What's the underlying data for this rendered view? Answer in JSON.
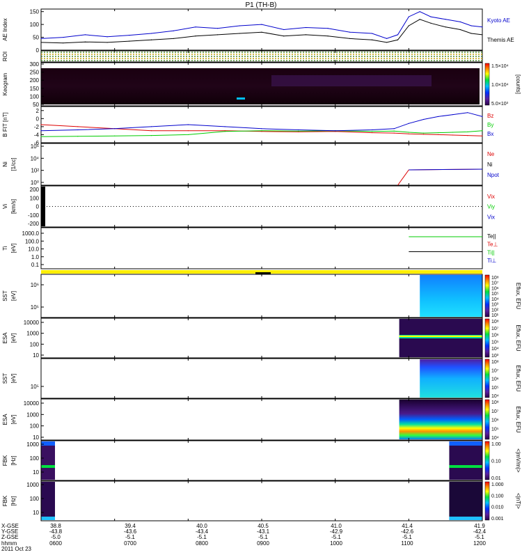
{
  "title": "P1 (TH-B)",
  "time_axis": {
    "ticks": [
      "0600",
      "0700",
      "0800",
      "0900",
      "1000",
      "1100",
      "1200"
    ],
    "header_rows": [
      "X-GSE",
      "Y-GSE",
      "Z-GSE",
      "hhmm"
    ],
    "columns": [
      {
        "x": "38.8",
        "y": "-43.8",
        "z": "-5.0",
        "t": "0600"
      },
      {
        "x": "39.4",
        "y": "-43.6",
        "z": "-5.1",
        "t": "0700"
      },
      {
        "x": "40.0",
        "y": "-43.4",
        "z": "-5.1",
        "t": "0800"
      },
      {
        "x": "40.5",
        "y": "-43.1",
        "z": "-5.1",
        "t": "0900"
      },
      {
        "x": "41.0",
        "y": "-42.9",
        "z": "-5.1",
        "t": "1000"
      },
      {
        "x": "41.4",
        "y": "-42.6",
        "z": "-5.1",
        "t": "1100"
      },
      {
        "x": "41.9",
        "y": "-42.4",
        "z": "-5.1",
        "t": "1200"
      }
    ],
    "date": "2011 Oct 23"
  },
  "chart_data": [
    {
      "type": "line",
      "ylabel": "AE Index",
      "yticks": [
        "150",
        "100",
        "50",
        "0"
      ],
      "ylim": [
        0,
        160
      ],
      "x": [
        6.0,
        6.3,
        6.6,
        6.9,
        7.2,
        7.5,
        7.8,
        8.1,
        8.4,
        8.7,
        9.0,
        9.3,
        9.6,
        9.9,
        10.2,
        10.5,
        10.7,
        10.85,
        11.0,
        11.15,
        11.3,
        11.5,
        11.7,
        11.85,
        12.0
      ],
      "series": [
        {
          "name": "Kyoto AE",
          "color": "#0000cc",
          "values": [
            45,
            50,
            60,
            52,
            58,
            65,
            75,
            90,
            85,
            95,
            100,
            80,
            88,
            85,
            70,
            65,
            45,
            60,
            130,
            150,
            130,
            120,
            110,
            95,
            90
          ]
        },
        {
          "name": "Themis AE",
          "color": "#000000",
          "values": [
            30,
            28,
            32,
            30,
            35,
            40,
            45,
            55,
            60,
            65,
            70,
            55,
            60,
            55,
            45,
            40,
            30,
            40,
            95,
            120,
            105,
            90,
            80,
            65,
            60
          ]
        }
      ]
    },
    {
      "type": "heatmap",
      "ylabel": "ROI",
      "note": "region of interest bar"
    },
    {
      "type": "heatmap",
      "ylabel": "Keogram",
      "yticks": [
        "300",
        "250",
        "200",
        "150",
        "100",
        "50"
      ],
      "colorbar": {
        "ticks": [
          "1.5×10⁴",
          "1.0×10⁴",
          "5.0×10³"
        ],
        "label": "[counts]"
      }
    },
    {
      "type": "line",
      "ylabel": "B FIT [nT]",
      "yticks": [
        "2",
        "0",
        "-2",
        "-4",
        "-6"
      ],
      "ylim": [
        -6,
        3
      ],
      "x": [
        6.0,
        6.5,
        7.0,
        7.5,
        8.0,
        8.5,
        9.0,
        9.5,
        10.0,
        10.5,
        10.8,
        11.0,
        11.2,
        11.4,
        11.6,
        11.8,
        12.0
      ],
      "series": [
        {
          "name": "Bz",
          "color": "#dd0000",
          "values": [
            -1.5,
            -2.0,
            -2.5,
            -3.0,
            -3.0,
            -3.0,
            -3.2,
            -3.3,
            -3.2,
            -3.5,
            -3.6,
            -3.8,
            -3.9,
            -4.0,
            -4.1,
            -4.2,
            -4.3
          ]
        },
        {
          "name": "By",
          "color": "#00cc00",
          "values": [
            -4.5,
            -4.4,
            -4.3,
            -4.2,
            -4.0,
            -3.2,
            -3.0,
            -3.1,
            -3.0,
            -3.2,
            -3.1,
            -3.4,
            -3.6,
            -3.5,
            -3.4,
            -3.3,
            -3.0
          ]
        },
        {
          "name": "Bx",
          "color": "#0000cc",
          "values": [
            -3.0,
            -2.8,
            -2.5,
            -2.0,
            -1.5,
            -2.0,
            -2.5,
            -2.8,
            -3.0,
            -2.8,
            -2.5,
            -1.2,
            -0.2,
            0.5,
            1.0,
            1.5,
            0.5
          ]
        }
      ]
    },
    {
      "type": "line",
      "ylabel": "Ni",
      "yticks": [
        "10⁶",
        "10⁴",
        "10²",
        "10⁰"
      ],
      "unit": "[1/cc]",
      "legend": [
        "Ne",
        "Ni",
        "Npot"
      ],
      "legend_colors": [
        "#dd0000",
        "#000000",
        "#0000cc"
      ]
    },
    {
      "type": "line",
      "ylabel": "Vi",
      "yticks": [
        "200",
        "100",
        "0",
        "-100",
        "-200"
      ],
      "unit": "[km/s]",
      "legend": [
        "Vix",
        "Viy",
        "Vix"
      ],
      "legend_colors": [
        "#dd0000",
        "#00cc00",
        "#0000cc"
      ]
    },
    {
      "type": "line",
      "ylabel": "Ti",
      "yticks": [
        "1000.0",
        "100.0",
        "10.0",
        "1.0",
        "0.1"
      ],
      "unit": "[eV]",
      "legend": [
        "Te||",
        "Te⊥",
        "Ti||",
        "Ti⊥"
      ],
      "legend_colors": [
        "#000000",
        "#dd0000",
        "#00cc00",
        "#0000cc"
      ]
    },
    {
      "type": "heatmap",
      "ylabel": "SST",
      "yticks": [
        "10⁶",
        "10⁵"
      ],
      "unit": "[eV]",
      "colorbar": {
        "ticks": [
          "10⁸",
          "10⁷",
          "10⁶",
          "10⁵",
          "10⁴",
          "10³",
          "10²",
          "10¹"
        ],
        "label": "Eflux, EFU"
      }
    },
    {
      "type": "heatmap",
      "ylabel": "ESA",
      "yticks": [
        "10000",
        "1000",
        "100",
        "10"
      ],
      "unit": "[eV]",
      "colorbar": {
        "ticks": [
          "10⁸",
          "10⁷",
          "10⁶",
          "10⁵",
          "10⁴",
          "10³"
        ],
        "label": "Eflux, EFU"
      }
    },
    {
      "type": "heatmap",
      "ylabel": "SST",
      "yticks": [
        "10⁵"
      ],
      "unit": "[eV]",
      "colorbar": {
        "ticks": [
          "10⁸",
          "10⁷",
          "10⁶",
          "10⁵",
          "10⁴"
        ],
        "label": "Eflux, EFU"
      }
    },
    {
      "type": "heatmap",
      "ylabel": "ESA",
      "yticks": [
        "10000",
        "1000",
        "100",
        "10"
      ],
      "unit": "[eV]",
      "colorbar": {
        "ticks": [
          "10⁸",
          "10⁷",
          "10⁶",
          "10⁵",
          "10⁴"
        ],
        "label": "Eflux, EFU"
      }
    },
    {
      "type": "heatmap",
      "ylabel": "FBK",
      "yticks": [
        "1000",
        "100",
        "10"
      ],
      "unit": "[Hz]",
      "colorbar": {
        "ticks": [
          "1.00",
          "0.10",
          "0.01"
        ],
        "label": "<|mV/m|>"
      }
    },
    {
      "type": "heatmap",
      "ylabel": "FBK",
      "yticks": [
        "1000",
        "100",
        "10"
      ],
      "unit": "[Hz]",
      "colorbar": {
        "ticks": [
          "1.000",
          "0.100",
          "0.010",
          "0.001"
        ],
        "label": "<|nT|>"
      }
    }
  ]
}
